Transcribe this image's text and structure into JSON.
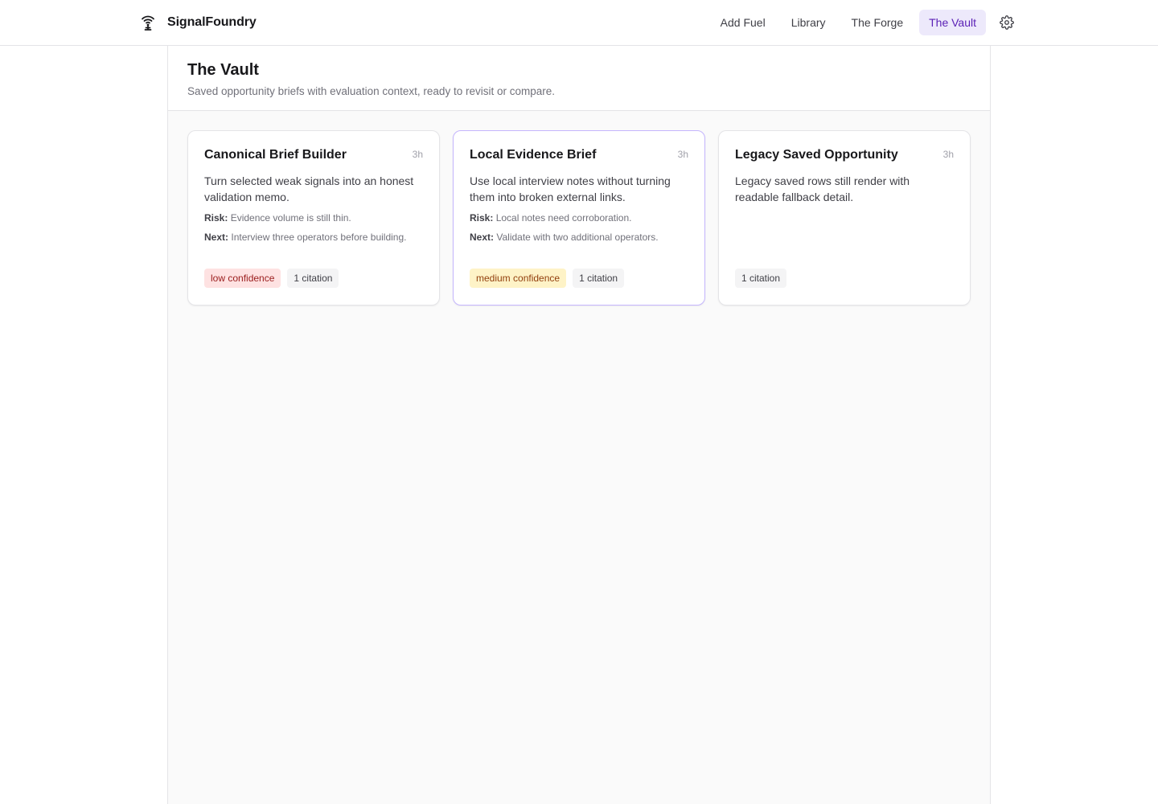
{
  "brand": {
    "name": "SignalFoundry",
    "icon": "broadcast-tower-icon"
  },
  "nav": {
    "items": [
      {
        "label": "Add Fuel",
        "active": false
      },
      {
        "label": "Library",
        "active": false
      },
      {
        "label": "The Forge",
        "active": false
      },
      {
        "label": "The Vault",
        "active": true
      }
    ],
    "settings_icon": "gear-icon"
  },
  "page": {
    "title": "The Vault",
    "subtitle": "Saved opportunity briefs with evaluation context, ready to revisit or compare."
  },
  "cards": [
    {
      "title": "Canonical Brief Builder",
      "time": "3h",
      "description": "Turn selected weak signals into an honest validation memo.",
      "risk_label": "Risk:",
      "risk": "Evidence volume is still thin.",
      "next_label": "Next:",
      "next": "Interview three operators before building.",
      "confidence": "low confidence",
      "citations": "1 citation"
    },
    {
      "title": "Local Evidence Brief",
      "time": "3h",
      "description": "Use local interview notes without turning them into broken external links.",
      "risk_label": "Risk:",
      "risk": "Local notes need corroboration.",
      "next_label": "Next:",
      "next": "Validate with two additional operators.",
      "confidence": "medium confidence",
      "citations": "1 citation"
    },
    {
      "title": "Legacy Saved Opportunity",
      "time": "3h",
      "description": "Legacy saved rows still render with readable fallback detail.",
      "citations": "1 citation"
    }
  ],
  "colors": {
    "accent": "#5b21b6",
    "active_nav_bg": "#ede9fb",
    "low_confidence_bg": "#fee2e2",
    "low_confidence_text": "#991b1b",
    "medium_confidence_bg": "#fef3c7",
    "medium_confidence_text": "#92400e"
  }
}
